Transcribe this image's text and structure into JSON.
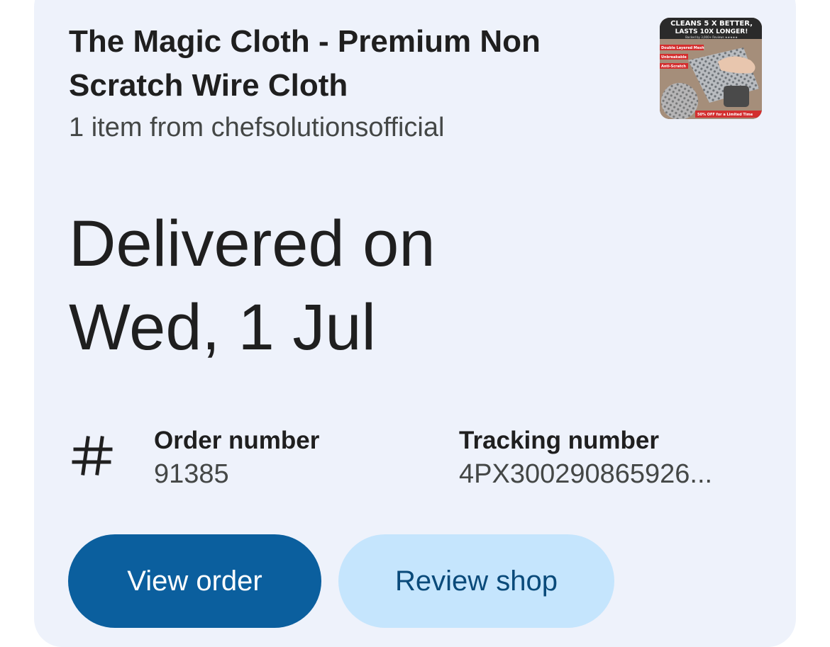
{
  "product": {
    "title": "The Magic Cloth - Premium Non Scratch Wire Cloth",
    "subtitle": "1 item from chefsolutionsofficial",
    "thumbnail_texts": {
      "line1": "CLEANS 5 X BETTER,",
      "line2": "LASTS 10X LONGER!",
      "line3": "Backed by 3,000+ Reviews ★★★★★",
      "tag1": "Double Layered Mesh",
      "tag2": "Unbreakable",
      "tag3": "Anti-Scratch",
      "footer": "50% OFF for a Limited Time"
    }
  },
  "delivery": {
    "line1": "Delivered on",
    "line2": "Wed, 1 Jul"
  },
  "order": {
    "icon": "hash-icon",
    "order_label": "Order number",
    "order_value": "91385",
    "tracking_label": "Tracking number",
    "tracking_value": "4PX300290865926..."
  },
  "actions": {
    "view_order": "View order",
    "review_shop": "Review shop"
  },
  "colors": {
    "card_bg": "#eef2fb",
    "primary_button": "#0b5f9e",
    "secondary_button": "#c5e5fd"
  }
}
